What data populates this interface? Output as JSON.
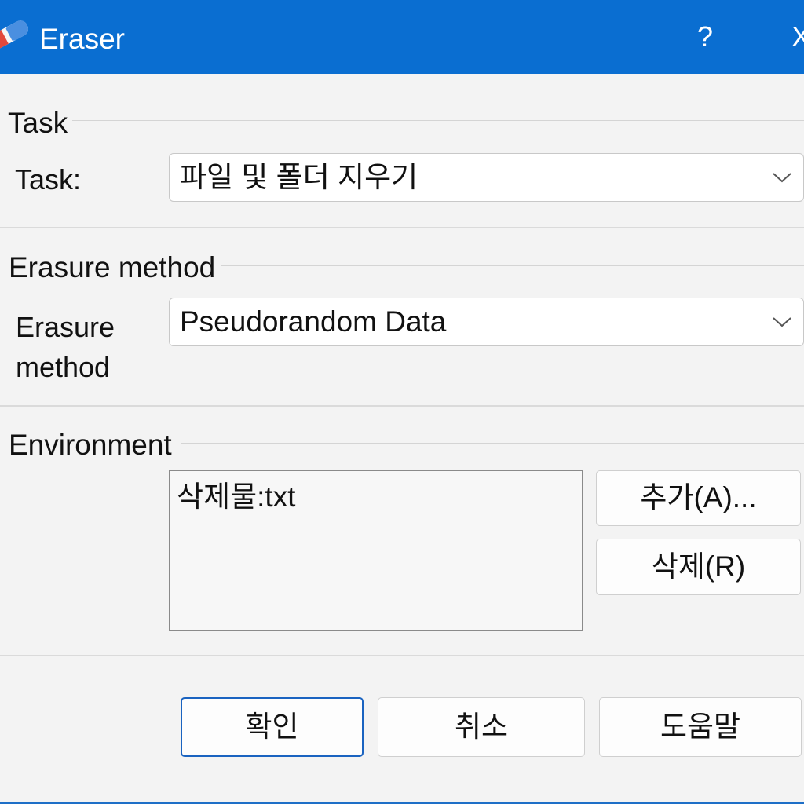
{
  "window": {
    "title": "Eraser",
    "help_label": "?",
    "close_label": "X",
    "app_icon": "eraser-icon",
    "accent_color": "#0a6ed1"
  },
  "task_section": {
    "title": "Task",
    "label": "Task:",
    "value": "파일 및 폴더 지우기"
  },
  "method_section": {
    "title": "Erasure method",
    "label_line1": "Erasure",
    "label_line2": "method",
    "value": "Pseudorandom Data"
  },
  "environment_section": {
    "title": "Environment",
    "items": [
      "삭제물:txt"
    ],
    "add_button": "추가(A)...",
    "remove_button": "삭제(R)"
  },
  "footer": {
    "ok_button": "확인",
    "cancel_button": "취소",
    "help_button": "도움말"
  }
}
